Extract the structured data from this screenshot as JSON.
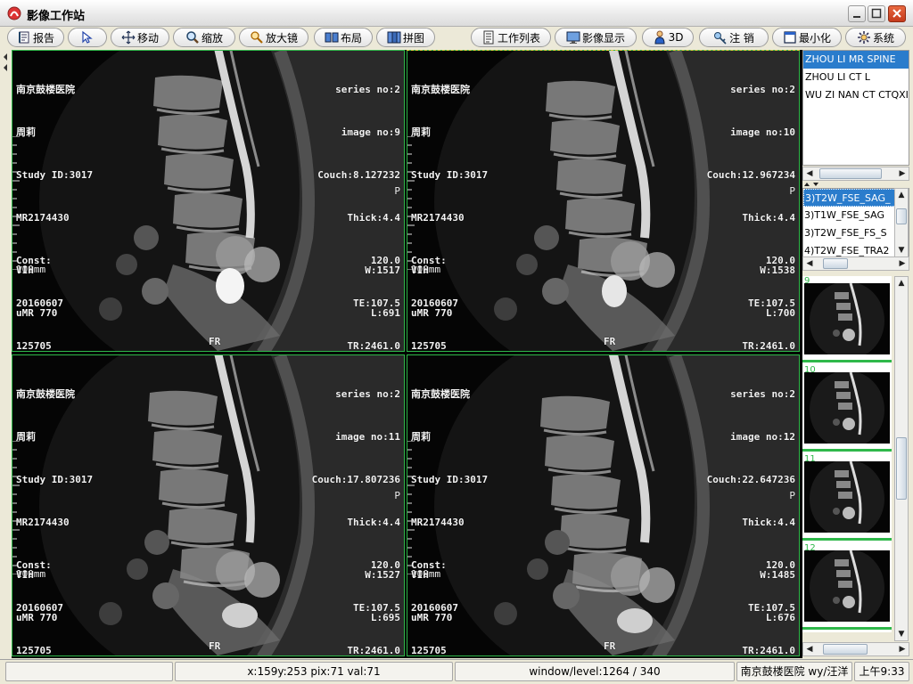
{
  "window": {
    "title": "影像工作站"
  },
  "toolbar": {
    "report": "报告",
    "select": "",
    "move": "移动",
    "zoom": "缩放",
    "magnifier": "放大镜",
    "layout": "布局",
    "stitch": "拼图",
    "worklist": "工作列表",
    "image_display": "影像显示",
    "three_d": "3D",
    "logout": "注 销",
    "minimize": "最小化",
    "system": "系统"
  },
  "viewports": [
    {
      "hospital": "南京鼓楼医院",
      "patient": "周莉",
      "study_id": "Study ID:3017",
      "mr": "MR2174430",
      "const": "Const:",
      "date": "20160607",
      "time": "125705",
      "series": "series no:2",
      "image": "image no:9",
      "couch": "Couch:8.127232",
      "thick": "Thick:4.4",
      "const_val": "120.0",
      "te": "TE:107.5",
      "tr": "TR:2461.0",
      "scale": "100mm",
      "orient": "P",
      "bottom_left_1": "VIH",
      "bottom_left_2": "uMR 770",
      "bottom_center": "FR",
      "w": "W:1517",
      "l": "L:691"
    },
    {
      "hospital": "南京鼓楼医院",
      "patient": "周莉",
      "study_id": "Study ID:3017",
      "mr": "MR2174430",
      "const": "Const:",
      "date": "20160607",
      "time": "125705",
      "series": "series no:2",
      "image": "image no:10",
      "couch": "Couch:12.967234",
      "thick": "Thick:4.4",
      "const_val": "120.0",
      "te": "TE:107.5",
      "tr": "TR:2461.0",
      "scale": "100mm",
      "orient": "P",
      "bottom_left_1": "VIH",
      "bottom_left_2": "uMR 770",
      "bottom_center": "FR",
      "w": "W:1538",
      "l": "L:700"
    },
    {
      "hospital": "南京鼓楼医院",
      "patient": "周莉",
      "study_id": "Study ID:3017",
      "mr": "MR2174430",
      "const": "Const:",
      "date": "20160607",
      "time": "125705",
      "series": "series no:2",
      "image": "image no:11",
      "couch": "Couch:17.807236",
      "thick": "Thick:4.4",
      "const_val": "120.0",
      "te": "TE:107.5",
      "tr": "TR:2461.0",
      "scale": "100mm",
      "orient": "P",
      "bottom_left_1": "VIH",
      "bottom_left_2": "uMR 770",
      "bottom_center": "FR",
      "w": "W:1527",
      "l": "L:695"
    },
    {
      "hospital": "南京鼓楼医院",
      "patient": "周莉",
      "study_id": "Study ID:3017",
      "mr": "MR2174430",
      "const": "Const:",
      "date": "20160607",
      "time": "125705",
      "series": "series no:2",
      "image": "image no:12",
      "couch": "Couch:22.647236",
      "thick": "Thick:4.4",
      "const_val": "120.0",
      "te": "TE:107.5",
      "tr": "TR:2461.0",
      "scale": "100mm",
      "orient": "P",
      "bottom_left_1": "VIH",
      "bottom_left_2": "uMR 770",
      "bottom_center": "FR",
      "w": "W:1485",
      "l": "L:676"
    }
  ],
  "patients": [
    "ZHOU LI MR SPINE",
    "ZHOU LI CT L",
    "WU ZI NAN CT CTQXI"
  ],
  "series_list": [
    "3)T2W_FSE_SAG_",
    "3)T1W_FSE_SAG",
    "3)T2W_FSE_FS_S",
    "4)T2W_FSE_TRA2"
  ],
  "thumbnails": [
    "9",
    "10",
    "11",
    "12"
  ],
  "status": {
    "cursor": "x:159y:253 pix:71 val:71",
    "window_level": "window/level:1264 / 340",
    "user": "南京鼓楼医院 wy/汪洋",
    "clock": "上午9:33"
  },
  "colors": {
    "viewport_border": "#2fb84a",
    "selection": "#2a7ccc",
    "active_border": "#d8c23a"
  }
}
